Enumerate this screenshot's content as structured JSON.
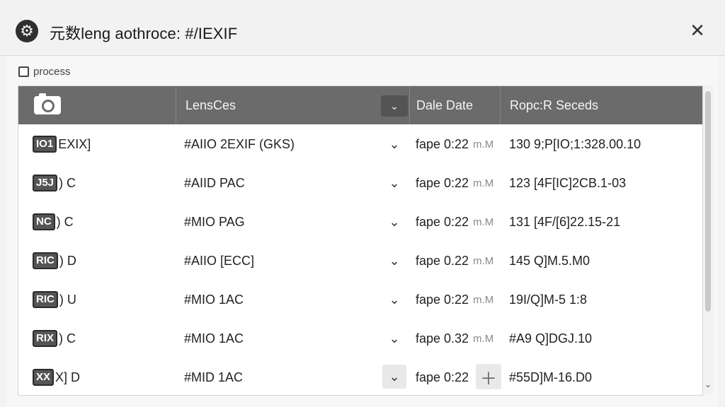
{
  "window": {
    "title": "元数leng aothroce: #/IEXIF",
    "gear_icon": "gear-icon",
    "close_icon": "close-icon",
    "close_glyph": "✕"
  },
  "process": {
    "label": "process",
    "checked": false
  },
  "table": {
    "columns": [
      {
        "label": ""
      },
      {
        "label": "LensCes"
      },
      {
        "label": "Dale Date"
      },
      {
        "label": "Ropc:R Seceds"
      }
    ],
    "sort_icon": "chevron-down-icon",
    "rows": [
      {
        "badge": "IO1",
        "suffix": "EXIX]",
        "lens": "#AIIO 2EXIF (GKS)",
        "time": "fape 0:22",
        "meta": "m.M",
        "value": "130 9;P[IO;1:328.00.10"
      },
      {
        "badge": "J5J",
        "suffix": ") C",
        "lens": "#AIID PAC",
        "time": "fape 0:22",
        "meta": "m.M",
        "value": "123 [4F[IC]2CB.1-03"
      },
      {
        "badge": "NC",
        "suffix": ") C",
        "lens": "#MIO PAG",
        "time": "fape 0:22",
        "meta": "m.M",
        "value": "131 [4F/[6]22.15-21"
      },
      {
        "badge": "RIC",
        "suffix": ") D",
        "lens": "#AIIO [ECC]",
        "time": "fape 0.22",
        "meta": "m.M",
        "value": "145 Q]M.5.M0"
      },
      {
        "badge": "RIC",
        "suffix": ") U",
        "lens": "#MIO 1AC",
        "time": "fape 0:22",
        "meta": "m.M",
        "value": "19I/Q]M-5 1:8"
      },
      {
        "badge": "RIX",
        "suffix": ") C",
        "lens": "#MIO 1AC",
        "time": "fape 0.32",
        "meta": "m.M",
        "value": "#A9 Q]DGJ.10"
      },
      {
        "badge": "XX",
        "suffix": "X] D",
        "lens": "#MID 1AC",
        "time": "fape 0:22",
        "meta": "",
        "value": "#55D]M-16.D0"
      }
    ]
  }
}
